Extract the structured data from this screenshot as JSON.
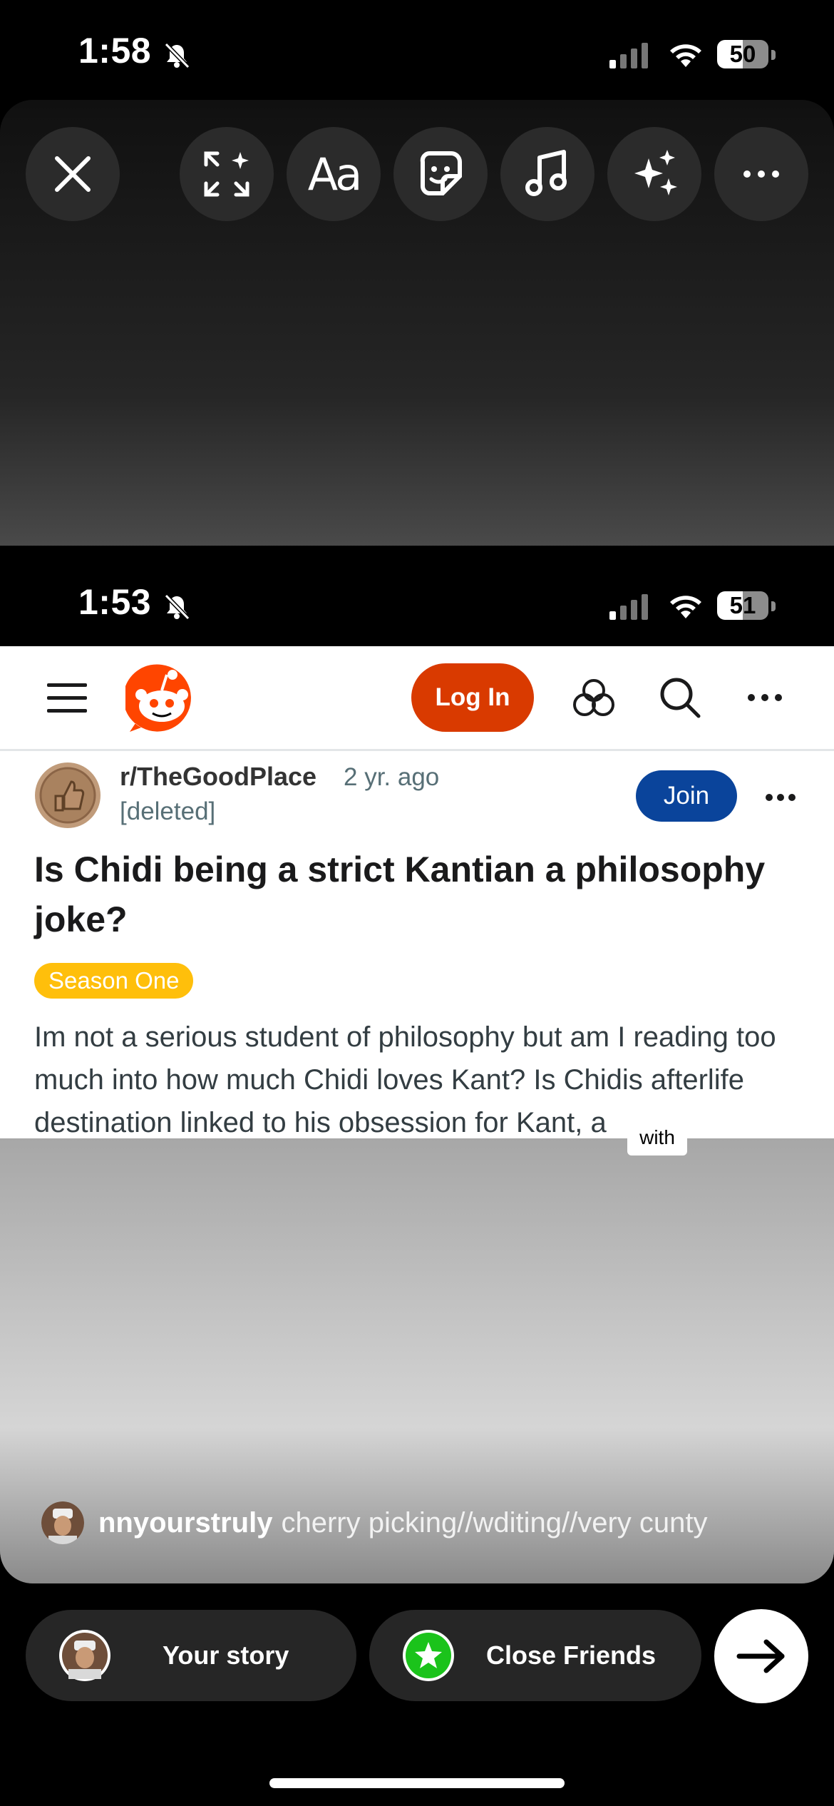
{
  "status_top": {
    "time": "1:58",
    "battery": "50"
  },
  "editor": {
    "tools": [
      {
        "name": "close-icon"
      },
      {
        "name": "resize-icon"
      },
      {
        "name": "text-tool",
        "label": "Aa"
      },
      {
        "name": "sticker-icon"
      },
      {
        "name": "music-icon"
      },
      {
        "name": "effects-sparkle-icon"
      },
      {
        "name": "more-icon"
      }
    ]
  },
  "screenshot": {
    "status": {
      "time": "1:53",
      "battery": "51"
    },
    "reddit": {
      "nav": {
        "login_label": "Log In"
      },
      "post": {
        "subreddit": "r/TheGoodPlace",
        "age": "2 yr. ago",
        "author": "[deleted]",
        "join_label": "Join",
        "title": "Is Chidi being a strict Kantian a philosophy joke?",
        "flair": "Season One",
        "body": "Im not a serious student of philosophy but am I reading too much into how much Chidi loves Kant? Is Chidis afterlife destination linked to his obsession for Kant, a"
      }
    },
    "sticker_text": "with"
  },
  "caption": {
    "username": "nnyourstruly",
    "text": "cherry picking//wditing//very cunty"
  },
  "share": {
    "your_story": "Your story",
    "close_friends": "Close Friends"
  },
  "colors": {
    "reddit_orange": "#d93a00",
    "join_blue": "#0a449b",
    "flair_yellow": "#ffbf0b",
    "close_friends_green": "#1bc31b"
  }
}
